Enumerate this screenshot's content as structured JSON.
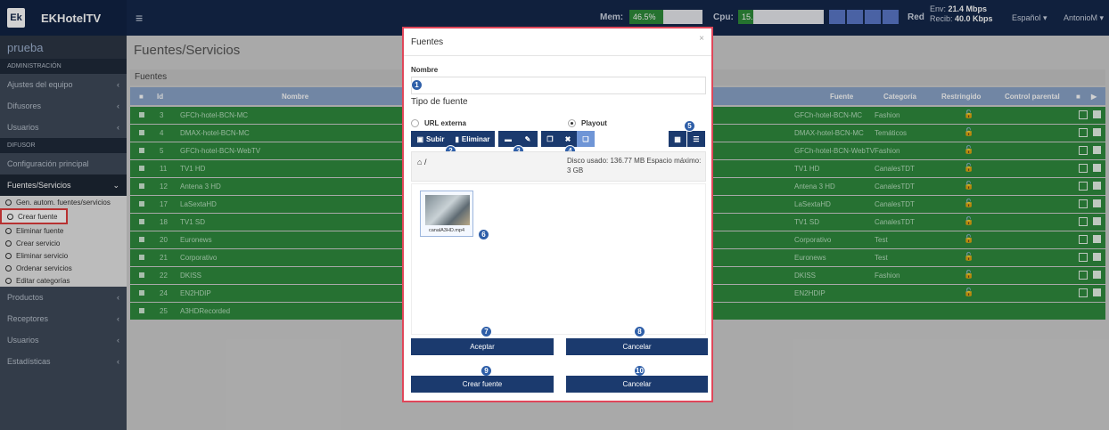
{
  "topbar": {
    "logo": "Ek",
    "title": "EKHotelTV",
    "mem_label": "Mem:",
    "mem_value": "46.5%",
    "mem_percent": 46.5,
    "cpu_label": "Cpu:",
    "cpu_value": "15.",
    "cpu_percent": 5,
    "red_label": "Red",
    "env_label": "Env:",
    "env_value": "21.4 Mbps",
    "recib_label": "Recib:",
    "recib_value": "40.0 Kbps",
    "language": "Español ▾",
    "user": "AntonioM ▾"
  },
  "sidebar": {
    "user": "prueba",
    "section_admin": "ADMINISTRACIÓN",
    "item_ajustes": "Ajustes del equipo",
    "item_difusores": "Difusores",
    "item_usuarios": "Usuarios",
    "section_difusor": "DIFUSOR",
    "item_config": "Configuración principal",
    "item_fuentes": "Fuentes/Servicios",
    "sub": [
      "Gen. autom. fuentes/servicios",
      "Crear fuente",
      "Eliminar fuente",
      "Crear servicio",
      "Eliminar servicio",
      "Ordenar servicios",
      "Editar categorías"
    ],
    "item_productos": "Productos",
    "item_receptores": "Receptores",
    "item_usuarios2": "Usuarios",
    "item_estadisticas": "Estadísticas"
  },
  "main": {
    "title": "Fuentes/Servicios",
    "panel": "Fuentes",
    "columns": {
      "id": "Id",
      "nombre": "Nombre",
      "fuente": "Fuente",
      "categoria": "Categoría",
      "restringido": "Restringido",
      "control": "Control parental"
    },
    "rows": [
      {
        "id": "3",
        "nombre": "GFCh-hotel-BCN-MC",
        "fuente": "GFCh-hotel-BCN-MC",
        "categoria": "Fashion"
      },
      {
        "id": "4",
        "nombre": "DMAX-hotel-BCN-MC",
        "fuente": "DMAX-hotel-BCN-MC",
        "categoria": "Temáticos"
      },
      {
        "id": "5",
        "nombre": "GFCh-hotel-BCN-WebTV",
        "fuente": "GFCh-hotel-BCN-WebTV",
        "categoria": "Fashion"
      },
      {
        "id": "11",
        "nombre": "TV1 HD",
        "fuente": "TV1 HD",
        "categoria": "CanalesTDT"
      },
      {
        "id": "12",
        "nombre": "Antena 3 HD",
        "fuente": "Antena 3 HD",
        "categoria": "CanalesTDT"
      },
      {
        "id": "17",
        "nombre": "LaSextaHD",
        "fuente": "LaSextaHD",
        "categoria": "CanalesTDT"
      },
      {
        "id": "18",
        "nombre": "TV1 SD",
        "fuente": "TV1 SD",
        "categoria": "CanalesTDT"
      },
      {
        "id": "20",
        "nombre": "Euronews",
        "fuente": "Corporativo",
        "categoria": "Test"
      },
      {
        "id": "21",
        "nombre": "Corporativo",
        "fuente": "Euronews",
        "categoria": "Test"
      },
      {
        "id": "22",
        "nombre": "DKISS",
        "fuente": "DKISS",
        "categoria": "Fashion"
      },
      {
        "id": "24",
        "nombre": "EN2HDIP",
        "fuente": "EN2HDIP",
        "categoria": ""
      },
      {
        "id": "25",
        "nombre": "A3HDRecorded",
        "fuente": "",
        "categoria": ""
      }
    ]
  },
  "modal": {
    "title": "Fuentes",
    "close": "×",
    "nombre_label": "Nombre",
    "nombre_value": "",
    "tipo_label": "Tipo de fuente",
    "url_externa": "URL externa",
    "playout": "Playout",
    "subir": "Subir",
    "eliminar": "Eliminar",
    "home": "/",
    "disk": "Disco usado: 136.77 MB Espacio máximo: 3 GB",
    "file_name": "canalA3HD.mp4",
    "aceptar": "Aceptar",
    "cancelar": "Cancelar",
    "crear_fuente": "Crear fuente",
    "cancelar2": "Cancelar",
    "badges": [
      "1",
      "2",
      "3",
      "4",
      "5",
      "6",
      "7",
      "8",
      "9",
      "10"
    ]
  }
}
